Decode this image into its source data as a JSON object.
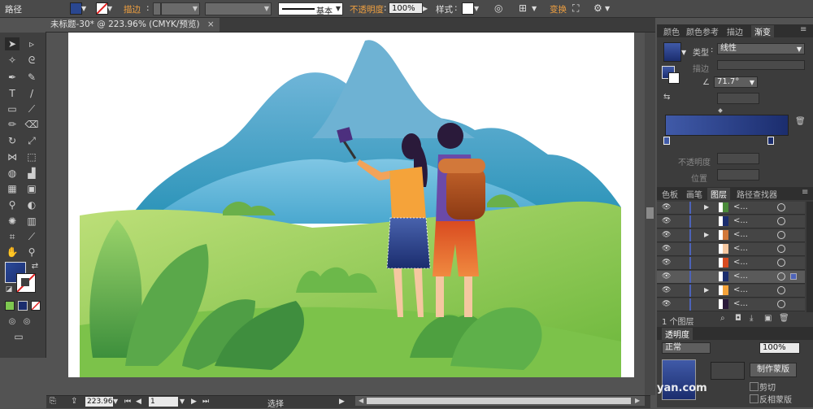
{
  "control_bar": {
    "selection_label": "路径",
    "stroke_label": "描边",
    "stroke_profile": "基本",
    "opacity_label": "不透明度",
    "opacity_value": "100%",
    "style_label": "样式",
    "transform_label": "变换"
  },
  "document": {
    "tab_title": "未标题-30* @ 223.96% (CMYK/预览)",
    "close_glyph": "×"
  },
  "status_bar": {
    "zoom_value": "223.96",
    "artboard_value": "1",
    "tool_status": "选择"
  },
  "panels": {
    "top_tabs": [
      "颜色",
      "颜色参考",
      "描边",
      "渐变"
    ],
    "gradient": {
      "type_label": "类型",
      "type_value": "线性",
      "stroke_label": "描边",
      "angle_value": "71.7°",
      "opacity_label": "不透明度",
      "position_label": "位置",
      "start_color": "#405aa8",
      "end_color": "#1b2d6e"
    },
    "layers_tabs": [
      "色板",
      "画笔",
      "图层",
      "路径查找器"
    ],
    "layers": [
      {
        "name": "<...",
        "tri": "▶"
      },
      {
        "name": "<...",
        "tri": ""
      },
      {
        "name": "<...",
        "tri": "▶"
      },
      {
        "name": "<...",
        "tri": ""
      },
      {
        "name": "<...",
        "tri": ""
      },
      {
        "name": "<...",
        "tri": ""
      },
      {
        "name": "<...",
        "tri": "▶"
      },
      {
        "name": "<...",
        "tri": ""
      }
    ],
    "layers_count": "1 个图层",
    "transparency_tab": "透明度",
    "blend_mode": "正常",
    "transparency_opacity": "100%",
    "make_mask_button": "制作蒙版",
    "clip_label": "剪切",
    "invert_mask_label": "反相蒙版"
  },
  "watermark": "yan.com"
}
